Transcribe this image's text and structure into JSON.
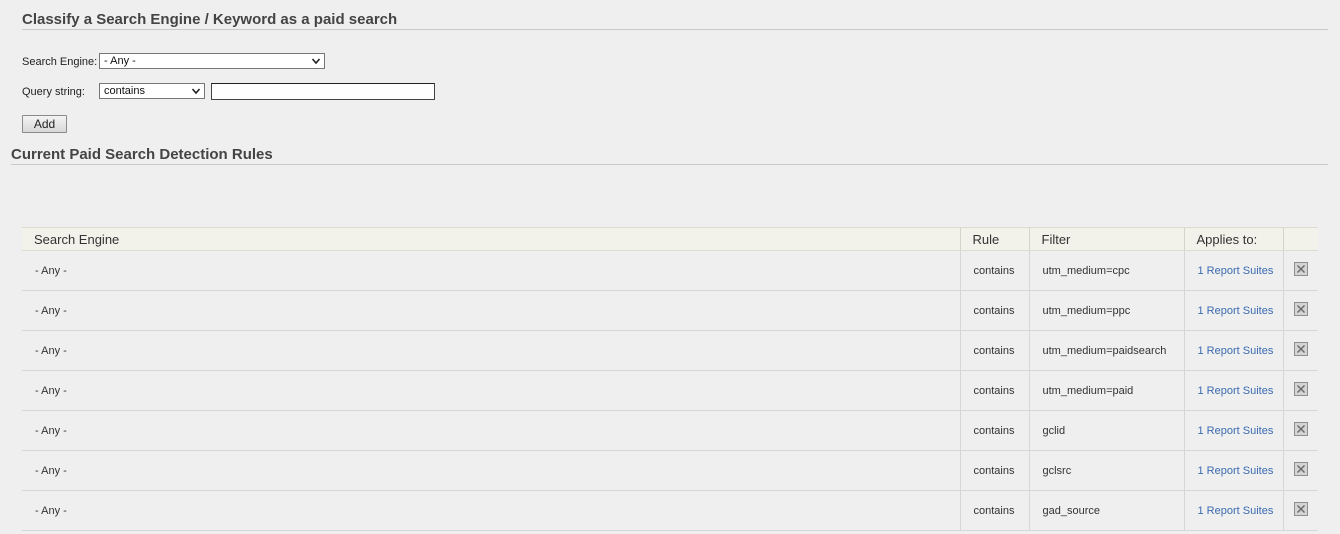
{
  "classify_section": {
    "title": "Classify a Search Engine / Keyword as a paid search",
    "search_engine_label": "Search Engine:",
    "search_engine_value": "- Any -",
    "query_string_label": "Query string:",
    "query_operator_value": "contains",
    "query_text_value": "",
    "add_button_label": "Add"
  },
  "rules_section": {
    "title": "Current Paid Search Detection Rules",
    "columns": {
      "search_engine": "Search Engine",
      "rule": "Rule",
      "filter": "Filter",
      "applies_to": "Applies to:"
    },
    "rows": [
      {
        "engine": "- Any -",
        "rule": "contains",
        "filter": "utm_medium=cpc",
        "applies_to": "1 Report Suites"
      },
      {
        "engine": "- Any -",
        "rule": "contains",
        "filter": "utm_medium=ppc",
        "applies_to": "1 Report Suites"
      },
      {
        "engine": "- Any -",
        "rule": "contains",
        "filter": "utm_medium=paidsearch",
        "applies_to": "1 Report Suites"
      },
      {
        "engine": "- Any -",
        "rule": "contains",
        "filter": "utm_medium=paid",
        "applies_to": "1 Report Suites"
      },
      {
        "engine": "- Any -",
        "rule": "contains",
        "filter": "gclid",
        "applies_to": "1 Report Suites"
      },
      {
        "engine": "- Any -",
        "rule": "contains",
        "filter": "gclsrc",
        "applies_to": "1 Report Suites"
      },
      {
        "engine": "- Any -",
        "rule": "contains",
        "filter": "gad_source",
        "applies_to": "1 Report Suites"
      }
    ]
  },
  "icons": {
    "dropdown": "chevron-down-icon",
    "delete": "delete-icon"
  },
  "colors": {
    "link": "#3a6ab0",
    "header_bg": "#f2f2ea",
    "page_bg": "#efefef"
  }
}
